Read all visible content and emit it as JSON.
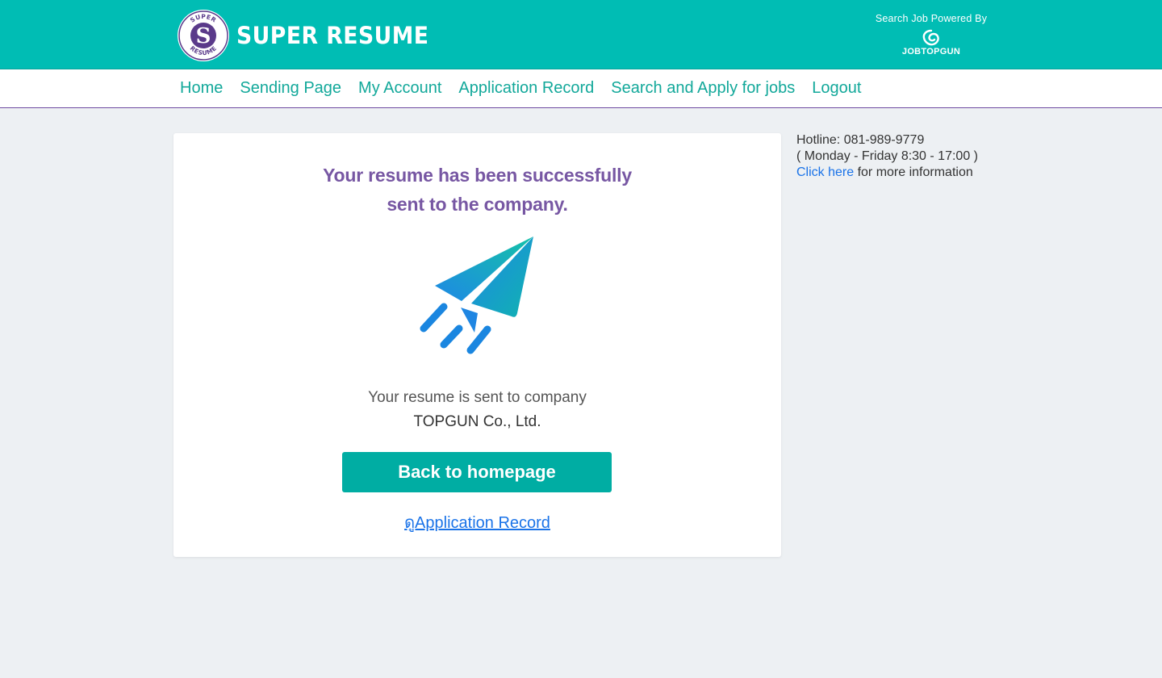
{
  "header": {
    "brand_name": "SUPER RESUME",
    "logo_ring_top": "SUPER",
    "logo_ring_bottom": "RESUME",
    "logo_letter": "S",
    "powered_by": "Search Job Powered By",
    "partner_name": "JOBTOPGUN"
  },
  "nav": {
    "items": [
      {
        "label": "Home"
      },
      {
        "label": "Sending Page"
      },
      {
        "label": "My Account"
      },
      {
        "label": "Application Record"
      },
      {
        "label": "Search and Apply for jobs"
      },
      {
        "label": "Logout"
      }
    ]
  },
  "main": {
    "title_line1": "Your resume has been successfully",
    "title_line2": "sent to the company.",
    "sent_text": "Your resume is sent to company",
    "company_name": "TOPGUN Co., Ltd.",
    "back_button": "Back to homepage",
    "record_link": "ดูApplication Record"
  },
  "sidebar": {
    "hotline": "Hotline: 081-989-9779",
    "hours": "( Monday - Friday 8:30 - 17:00 )",
    "link_text": "Click here",
    "link_suffix": " for more information"
  },
  "colors": {
    "header_bg": "#00bdb4",
    "nav_text": "#12a89a",
    "title_purple": "#7757a3",
    "button_bg": "#00ada3",
    "link_blue": "#1a73e8",
    "page_bg": "#edf0f3"
  },
  "icons": {
    "brand_logo": "super-resume-logo-icon",
    "partner_logo": "jobtopgun-swirl-icon",
    "hero": "paper-plane-icon"
  }
}
